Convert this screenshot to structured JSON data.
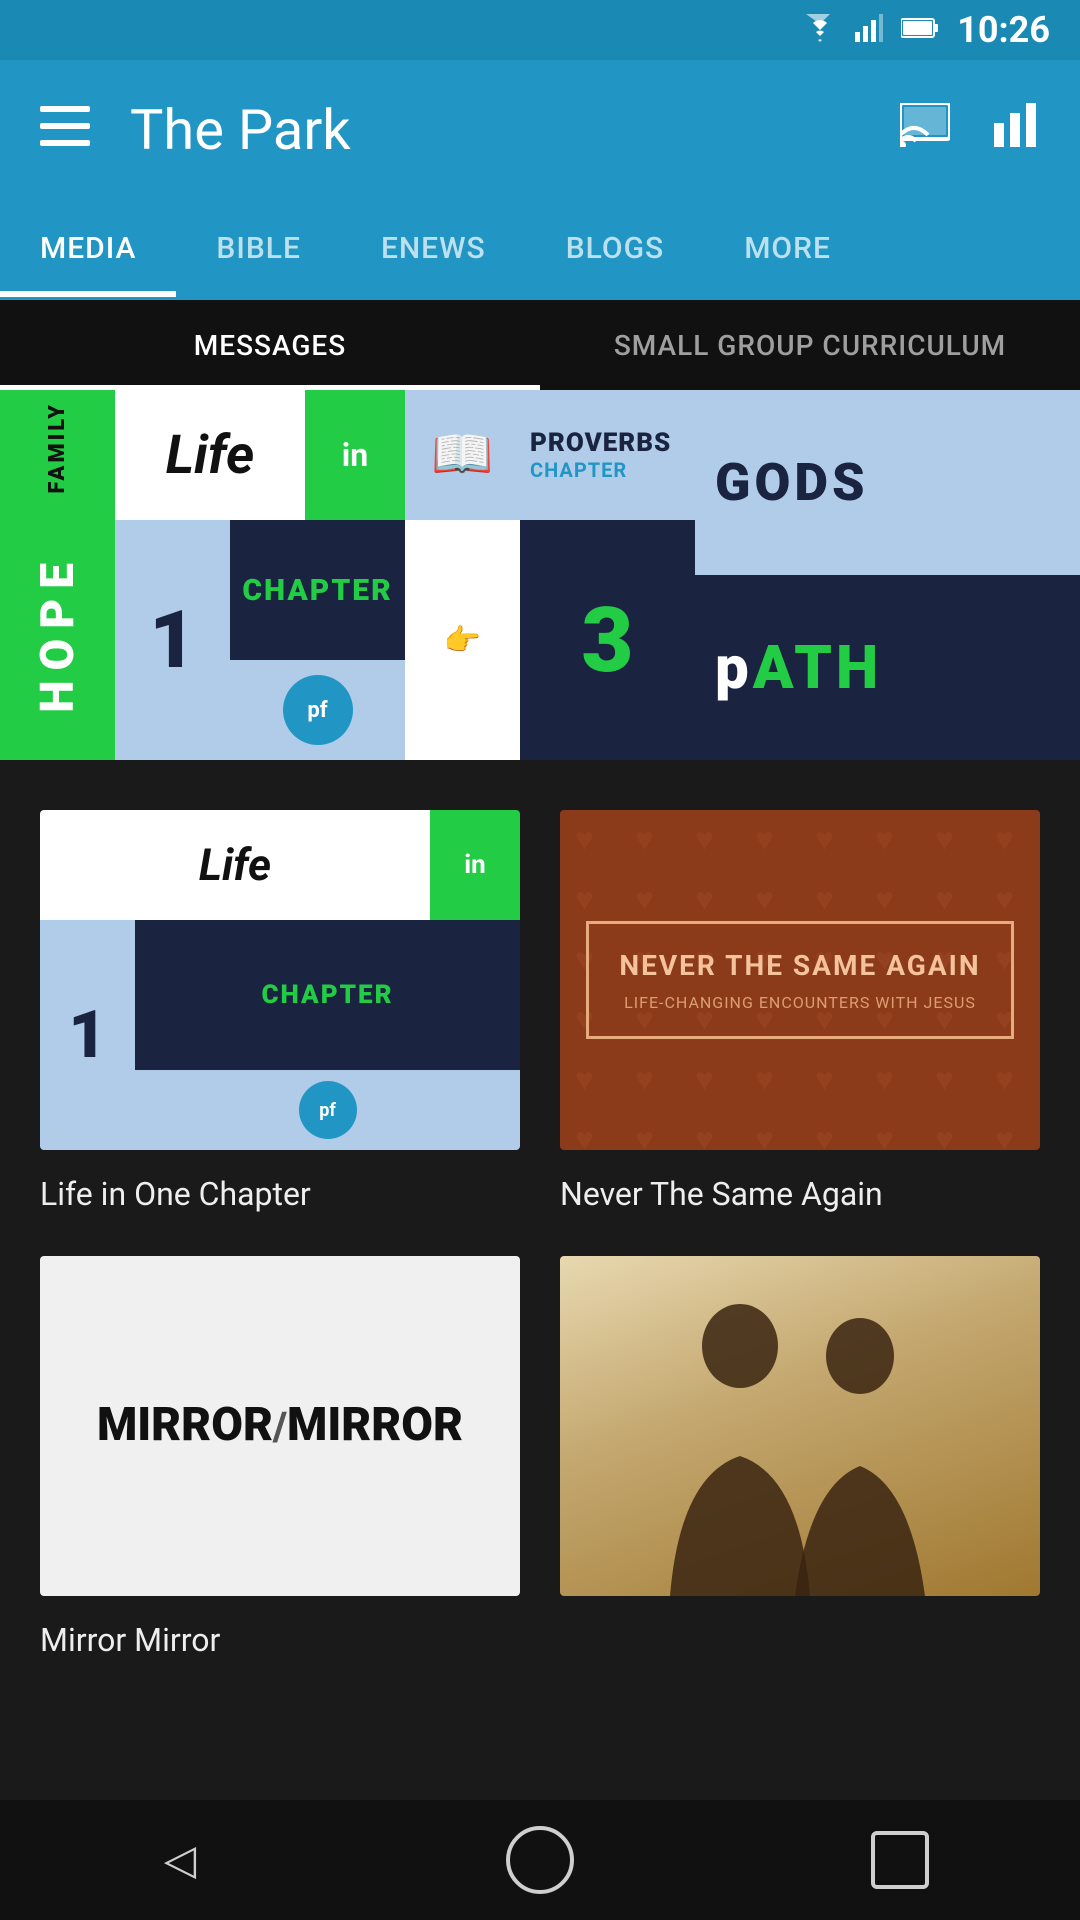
{
  "statusBar": {
    "time": "10:26"
  },
  "appBar": {
    "title": "The Park"
  },
  "tabs": [
    {
      "label": "MEDIA",
      "active": true
    },
    {
      "label": "BIBLE",
      "active": false
    },
    {
      "label": "ENEWS",
      "active": false
    },
    {
      "label": "BLOGS",
      "active": false
    },
    {
      "label": "MORE",
      "active": false
    }
  ],
  "subTabs": [
    {
      "label": "MESSAGES",
      "active": true
    },
    {
      "label": "SMALL GROUP CURRICULUM",
      "active": false
    }
  ],
  "banner": {
    "family": "FAMILY",
    "hope": "HOPE",
    "life": "Life",
    "in": "in",
    "chapter_num": "1",
    "chapter": "CHAPTER",
    "pf": "pf",
    "proverbs": "PROVERBS",
    "proverbs_sub": "CHAPTER",
    "three": "3",
    "gods": "GODS",
    "path": "pATH"
  },
  "cards": [
    {
      "id": "life-in-one-chapter",
      "title": "Life in One Chapter",
      "life_text": "Life",
      "in_text": "in",
      "num": "1",
      "chapter": "CHAPTER",
      "pf": "pf"
    },
    {
      "id": "never-the-same-again",
      "title": "Never The Same Again",
      "subtitle": "LIFE-CHANGING ENCOUNTERS WITH JESUS",
      "box_title": "NEVER THE SAME AGAIN"
    },
    {
      "id": "mirror-mirror",
      "title": "Mirror Mirror",
      "display": "MIRROR/MIRROR"
    },
    {
      "id": "fourth-card",
      "title": ""
    }
  ],
  "bottomNav": {
    "back": "back",
    "home": "home",
    "recent": "recent"
  }
}
